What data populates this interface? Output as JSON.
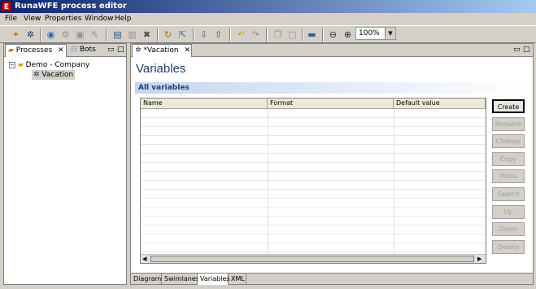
{
  "window": {
    "title": "RunaWFE process editor",
    "app_icon": "E"
  },
  "menu": [
    "File",
    "View",
    "Properties",
    "Window",
    "Help"
  ],
  "toolbar": {
    "zoom": "100%"
  },
  "left_panel": {
    "tabs": [
      {
        "label": "Processes"
      },
      {
        "label": "Bots"
      }
    ],
    "tree": {
      "root": "Demo - Company",
      "child": "Vacation"
    }
  },
  "editor": {
    "tab_label": "*Vacation",
    "heading": "Variables",
    "section_title": "All variables",
    "columns": [
      "Name",
      "Format",
      "Default value"
    ],
    "rows": [],
    "buttons": [
      {
        "label": "Create",
        "enabled": true
      },
      {
        "label": "Rename",
        "enabled": false
      },
      {
        "label": "Change",
        "enabled": false
      },
      {
        "label": "Copy",
        "enabled": false
      },
      {
        "label": "Paste",
        "enabled": false
      },
      {
        "label": "Search",
        "enabled": false
      },
      {
        "label": "Up",
        "enabled": false
      },
      {
        "label": "Down",
        "enabled": false
      },
      {
        "label": "Delete",
        "enabled": false
      }
    ],
    "bottom_tabs": [
      "Diagram",
      "Swimlanes",
      "Variables",
      "XML"
    ],
    "active_bottom_tab": "Variables"
  }
}
